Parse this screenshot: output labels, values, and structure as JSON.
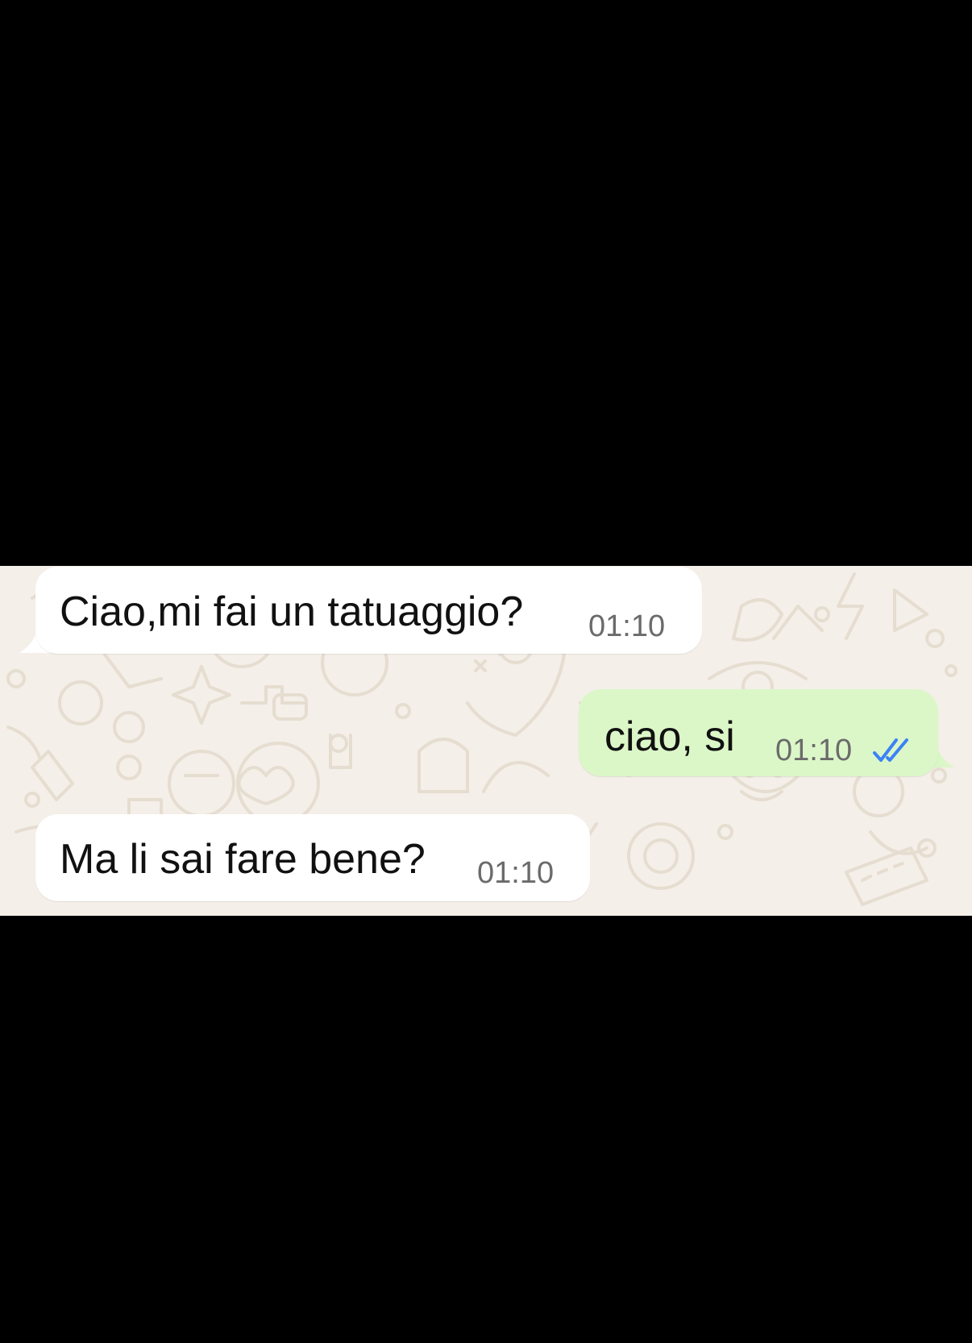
{
  "colors": {
    "background": "#000000",
    "chat_wallpaper": "#f4efe8",
    "incoming_bubble": "#ffffff",
    "outgoing_bubble": "#dbf7c8",
    "read_ticks": "#3b82f6"
  },
  "messages": [
    {
      "direction": "incoming",
      "text": "Ciao,mi fai un tatuaggio?",
      "time": "01:10"
    },
    {
      "direction": "outgoing",
      "text": "ciao, si",
      "time": "01:10",
      "status_icon": "double-check-read-icon"
    },
    {
      "direction": "incoming",
      "text": "Ma li sai fare bene?",
      "time": "01:10"
    }
  ]
}
